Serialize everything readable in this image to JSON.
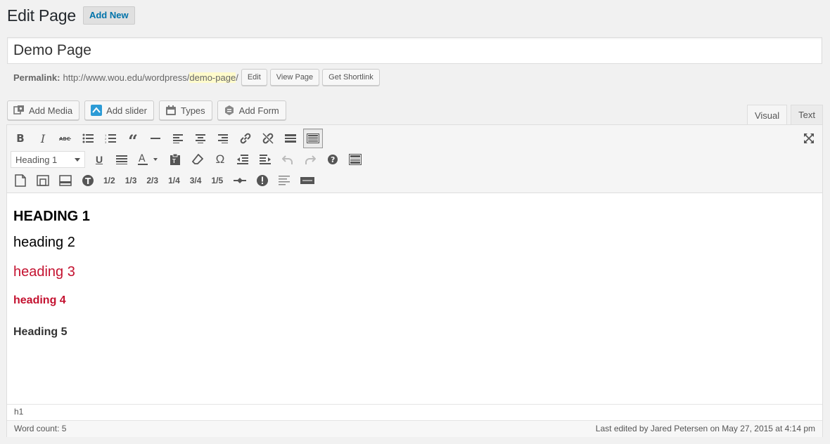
{
  "header": {
    "title": "Edit Page",
    "add_new": "Add New"
  },
  "title_field": {
    "value": "Demo Page"
  },
  "permalink": {
    "label": "Permalink:",
    "base": "http://www.wou.edu/wordpress/",
    "slug": "demo-page",
    "trail": "/",
    "edit": "Edit",
    "view": "View Page",
    "shortlink": "Get Shortlink"
  },
  "media_buttons": {
    "add_media": "Add Media",
    "add_slider": "Add slider",
    "types": "Types",
    "add_form": "Add Form"
  },
  "editor_tabs": {
    "visual": "Visual",
    "text": "Text"
  },
  "toolbar": {
    "format_selected": "Heading 1",
    "columns": [
      "1/2",
      "1/3",
      "2/3",
      "1/4",
      "3/4",
      "1/5"
    ]
  },
  "content": {
    "h1": "HEADING 1",
    "h2": "heading 2",
    "h3": "heading 3",
    "h4": "heading 4",
    "h5": "Heading 5"
  },
  "path": "h1",
  "status": {
    "word_count": "Word count: 5",
    "last_edited": "Last edited by Jared Petersen on May 27, 2015 at 4:14 pm"
  },
  "colors": {
    "accent_link": "#0073aa",
    "heading_red": "#c41230",
    "slug_highlight": "#fffbcc"
  }
}
